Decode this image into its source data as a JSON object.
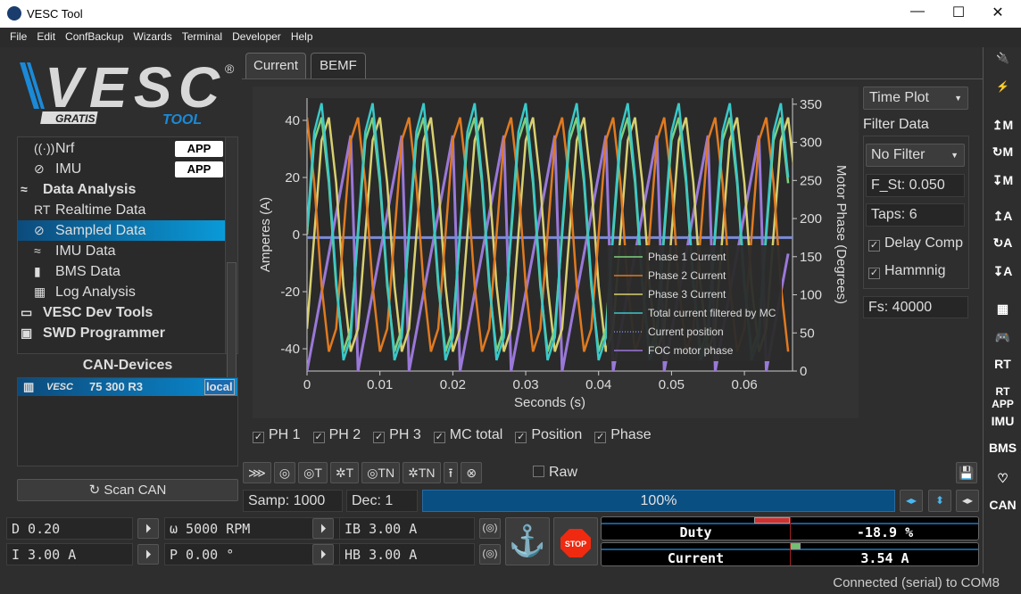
{
  "window": {
    "title": "VESC Tool",
    "minimize": "—",
    "maximize": "☐",
    "close": "✕"
  },
  "menu": [
    "File",
    "Edit",
    "ConfBackup",
    "Wizards",
    "Terminal",
    "Developer",
    "Help"
  ],
  "logo": {
    "text": "VESC",
    "badge": "GRATIS",
    "sub": "TOOL",
    "reg": "®"
  },
  "tree": [
    {
      "label": "Nrf",
      "icon": "radio-icon",
      "glyph": "((·))",
      "badge": "APP",
      "level": "sub"
    },
    {
      "label": "IMU",
      "icon": "imu-icon",
      "glyph": "⊘",
      "badge": "APP",
      "level": "sub"
    },
    {
      "label": "Data Analysis",
      "icon": "chart-icon",
      "glyph": "≈",
      "level": "top"
    },
    {
      "label": "Realtime Data",
      "icon": "realtime-icon",
      "glyph": "RT",
      "level": "sub"
    },
    {
      "label": "Sampled Data",
      "icon": "sampled-icon",
      "glyph": "⊘",
      "level": "sub",
      "selected": true
    },
    {
      "label": "IMU Data",
      "icon": "imu-data-icon",
      "glyph": "≈",
      "level": "sub"
    },
    {
      "label": "BMS Data",
      "icon": "battery-icon",
      "glyph": "▮",
      "level": "sub"
    },
    {
      "label": "Log Analysis",
      "icon": "map-icon",
      "glyph": "▦",
      "level": "sub"
    },
    {
      "label": "VESC Dev Tools",
      "icon": "terminal-icon",
      "glyph": "▭",
      "level": "top"
    },
    {
      "label": "SWD Programmer",
      "icon": "chip-icon",
      "glyph": "▣",
      "level": "top"
    }
  ],
  "can": {
    "title": "CAN-Devices",
    "device": "75 300 R3",
    "device_brand": "VESC",
    "device_tag": "local",
    "scan": "↻ Scan CAN"
  },
  "tabs": [
    {
      "label": "Current",
      "active": true
    },
    {
      "label": "BEMF",
      "active": false
    }
  ],
  "plot_controls": {
    "mode": "Time Plot",
    "filter_title": "Filter Data",
    "filter": "No Filter",
    "f_st": "F_St: 0.050",
    "taps": "Taps: 6",
    "delay_comp": {
      "label": "Delay Comp",
      "checked": true
    },
    "hamming": {
      "label": "Hammnig",
      "checked": true
    },
    "fs": "Fs: 40000"
  },
  "series_checks": [
    {
      "label": "PH 1",
      "checked": true
    },
    {
      "label": "PH 2",
      "checked": true
    },
    {
      "label": "PH 3",
      "checked": true
    },
    {
      "label": "MC total",
      "checked": true
    },
    {
      "label": "Position",
      "checked": true
    },
    {
      "label": "Phase",
      "checked": true
    }
  ],
  "toolbar": {
    "buttons": [
      "⋙",
      "◎",
      "◎T",
      "✲T",
      "◎TN",
      "✲TN",
      "⭱",
      "⊗"
    ],
    "raw": "Raw",
    "raw_checked": false,
    "samp": "Samp: 1000",
    "dec": "Dec: 1",
    "progress_text": "100%",
    "progress": 100
  },
  "motor": {
    "duty": "D 0.20",
    "rpm": "ω 5000 RPM",
    "ib": "IB 3.00 A",
    "current": "I 3.00 A",
    "pos": "P 0.00 °",
    "hb": "HB 3.00 A",
    "stop": "STOP"
  },
  "gauges": [
    {
      "label": "Duty",
      "value": "-18.9 %",
      "fraction": -0.189
    },
    {
      "label": "Current",
      "value": "3.54 A",
      "fraction": 0.04
    }
  ],
  "right_bar": [
    "plug-connect-icon",
    "plug-disconnect-icon",
    "↥M",
    "↻M",
    "↧M",
    "↥A",
    "↻A",
    "↧A",
    "▦",
    "🎮",
    "RT",
    "RT APP",
    "IMU",
    "BMS",
    "♡",
    "CAN"
  ],
  "status": "Connected (serial) to COM8",
  "chart_data": {
    "type": "line",
    "xlabel": "Seconds (s)",
    "ylabel": "Amperes (A)",
    "y2label": "Motor Phase (Degrees)",
    "xlim": [
      0,
      0.0666
    ],
    "ylim": [
      -47.8,
      47.8
    ],
    "y2lim": [
      0,
      358
    ],
    "xticks": [
      0,
      0.01,
      0.02,
      0.03,
      0.04,
      0.05,
      0.06
    ],
    "xtick_labels": [
      "0",
      "0.01",
      "0.02",
      "0.03",
      "0.04",
      "0.05",
      "0.06"
    ],
    "yticks": [
      -40,
      -20,
      0,
      20,
      40
    ],
    "y2ticks": [
      0,
      50,
      100,
      150,
      200,
      250,
      300,
      350
    ],
    "legend": "bottom-right",
    "grid": false,
    "x_start": 0,
    "x_step": 0.001,
    "series": [
      {
        "name": "Phase 1 Current",
        "color": "#7fd07f",
        "axis": "left",
        "values": [
          0,
          33,
          41,
          18,
          -18,
          -41,
          -33,
          0,
          33,
          41,
          18,
          -18,
          -41,
          -33,
          0,
          33,
          41,
          18,
          -18,
          -41,
          -33,
          0,
          33,
          41,
          18,
          -18,
          -41,
          -33,
          0,
          33,
          41,
          18,
          -18,
          -41,
          -33,
          0,
          33,
          41,
          18,
          -18,
          -41,
          -33,
          0,
          33,
          41,
          18,
          -18,
          -41,
          -33,
          0,
          33,
          41,
          18,
          -18,
          -41,
          -33,
          0,
          33,
          41,
          18,
          -18,
          -41,
          -33,
          0,
          33,
          41,
          18
        ]
      },
      {
        "name": "Phase 2 Current",
        "color": "#e07a20",
        "axis": "left",
        "values": [
          41,
          18,
          -18,
          -41,
          -33,
          0,
          33,
          41,
          18,
          -18,
          -41,
          -33,
          0,
          33,
          41,
          18,
          -18,
          -41,
          -33,
          0,
          33,
          41,
          18,
          -18,
          -41,
          -33,
          0,
          33,
          41,
          18,
          -18,
          -41,
          -33,
          0,
          33,
          41,
          18,
          -18,
          -41,
          -33,
          0,
          33,
          41,
          18,
          -18,
          -41,
          -33,
          0,
          33,
          41,
          18,
          -18,
          -41,
          -33,
          0,
          33,
          41,
          18,
          -18,
          -41,
          -33,
          0,
          33,
          41,
          18,
          -18,
          -41
        ]
      },
      {
        "name": "Phase 3 Current",
        "color": "#d8d070",
        "axis": "left",
        "values": [
          -33,
          0,
          33,
          41,
          18,
          -18,
          -41,
          -33,
          0,
          33,
          41,
          18,
          -18,
          -41,
          -33,
          0,
          33,
          41,
          18,
          -18,
          -41,
          -33,
          0,
          33,
          41,
          18,
          -18,
          -41,
          -33,
          0,
          33,
          41,
          18,
          -18,
          -41,
          -33,
          0,
          33,
          41,
          18,
          -18,
          -41,
          -33,
          0,
          33,
          41,
          18,
          -18,
          -41,
          -33,
          0,
          33,
          41,
          18,
          -18,
          -41,
          -33,
          0,
          33,
          41,
          18,
          -18,
          -41,
          -33,
          0,
          33,
          41,
          18,
          -18
        ]
      },
      {
        "name": "Total current filtered by MC",
        "color": "#3ac8c8",
        "axis": "left",
        "values": [
          2,
          36,
          46,
          20,
          -16,
          -44,
          -36,
          2,
          36,
          46,
          20,
          -16,
          -44,
          -36,
          2,
          36,
          46,
          20,
          -16,
          -44,
          -36,
          2,
          36,
          46,
          20,
          -16,
          -44,
          -36,
          2,
          36,
          46,
          20,
          -16,
          -44,
          -36,
          2,
          36,
          46,
          20,
          -16,
          -44,
          -36,
          2,
          36,
          46,
          20,
          -16,
          -44,
          -36,
          2,
          36,
          46,
          20,
          -16,
          -44,
          -36,
          2,
          36,
          46,
          20,
          -16,
          -44,
          -36,
          2,
          36,
          46,
          20
        ]
      },
      {
        "name": "Current position",
        "color": "#7a8ad8",
        "axis": "right",
        "dotted": true,
        "values": [
          175,
          175
        ]
      },
      {
        "name": "FOC motor phase",
        "color": "#9a78d8",
        "axis": "right",
        "values": [
          0,
          51,
          103,
          154,
          206,
          257,
          309,
          0,
          51,
          103,
          154,
          206,
          257,
          309,
          0,
          51,
          103,
          154,
          206,
          257,
          309,
          0,
          51,
          103,
          154,
          206,
          257,
          309,
          0,
          51,
          103,
          154,
          206,
          257,
          309,
          0,
          51,
          103,
          154,
          206,
          257,
          309,
          0,
          51,
          103,
          154,
          206,
          257,
          309,
          0,
          51,
          103,
          154,
          206,
          257,
          309,
          0,
          51,
          103,
          154,
          206,
          257,
          309,
          0,
          51,
          103,
          154
        ]
      }
    ]
  }
}
